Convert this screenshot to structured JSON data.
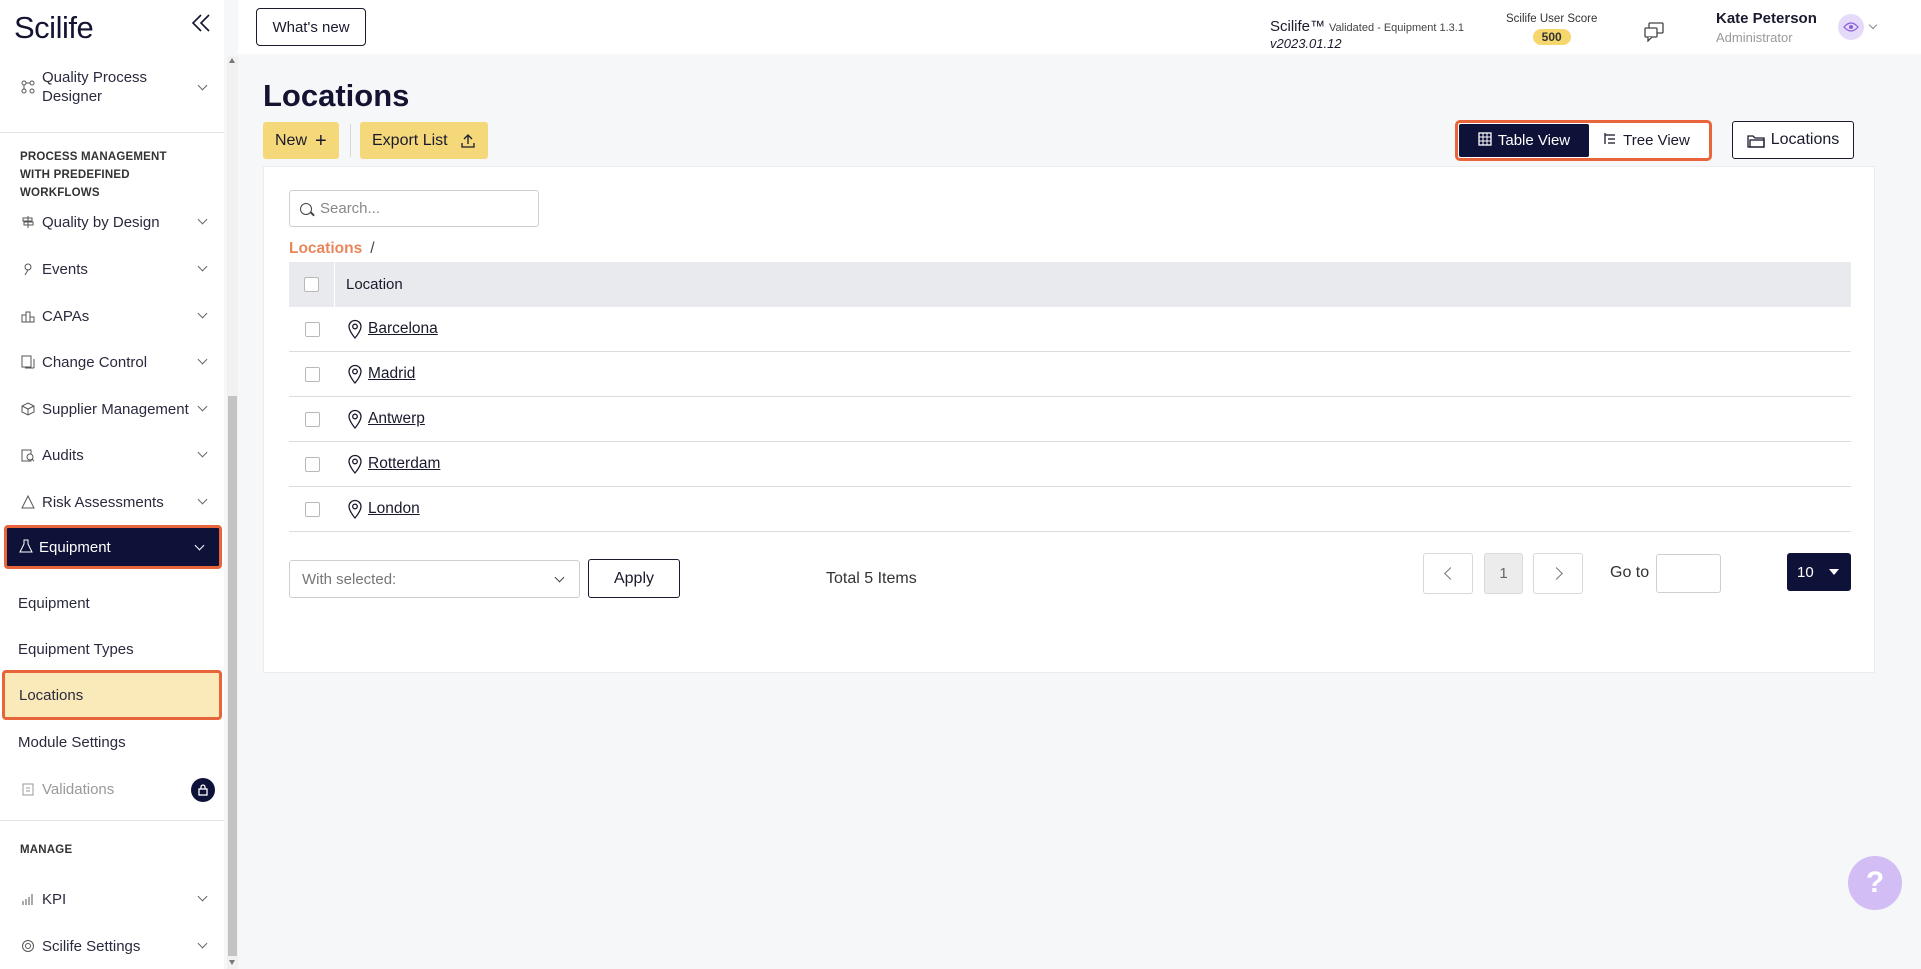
{
  "brand": "Scilife",
  "header": {
    "whats_new": "What's new",
    "product": "Scilife™",
    "validated": "Validated - Equipment 1.3.1",
    "version": "v2023.01.12",
    "score_label": "Scilife User Score",
    "score_value": "500",
    "user_name": "Kate Peterson",
    "user_role": "Administrator"
  },
  "sidebar": {
    "top_item": "Quality Process Designer",
    "section_process": "PROCESS MANAGEMENT WITH PREDEFINED WORKFLOWS",
    "items": [
      {
        "label": "Quality by Design",
        "icon": "signpost-icon"
      },
      {
        "label": "Events",
        "icon": "pin-icon"
      },
      {
        "label": "CAPAs",
        "icon": "capa-icon"
      },
      {
        "label": "Change Control",
        "icon": "change-icon"
      },
      {
        "label": "Supplier Management",
        "icon": "box-icon"
      },
      {
        "label": "Audits",
        "icon": "clipboard-search-icon"
      },
      {
        "label": "Risk Assessments",
        "icon": "warning-triangle-icon"
      }
    ],
    "active_item": "Equipment",
    "sub_items": [
      "Equipment",
      "Equipment Types",
      "Locations",
      "Module Settings"
    ],
    "validations": "Validations",
    "section_manage": "MANAGE",
    "manage_items": [
      {
        "label": "KPI",
        "icon": "chart-icon"
      },
      {
        "label": "Scilife Settings",
        "icon": "settings-icon"
      }
    ]
  },
  "main": {
    "title": "Locations",
    "new_button": "New",
    "export_button": "Export List",
    "table_view": "Table View",
    "tree_view": "Tree View",
    "locations_button": "Locations",
    "search_placeholder": "Search...",
    "breadcrumb_root": "Locations",
    "breadcrumb_sep": "/",
    "column_location": "Location",
    "rows": [
      "Barcelona",
      "Madrid",
      "Antwerp",
      "Rotterdam",
      "London"
    ],
    "with_selected": "With selected:",
    "apply": "Apply",
    "total": "Total 5 Items",
    "current_page": "1",
    "goto_label": "Go to",
    "page_size": "10"
  },
  "colors": {
    "navy": "#0f1238",
    "accent_yellow": "#f5d87a",
    "highlight_orange": "#e8643a",
    "breadcrumb_orange": "#e8875c"
  }
}
